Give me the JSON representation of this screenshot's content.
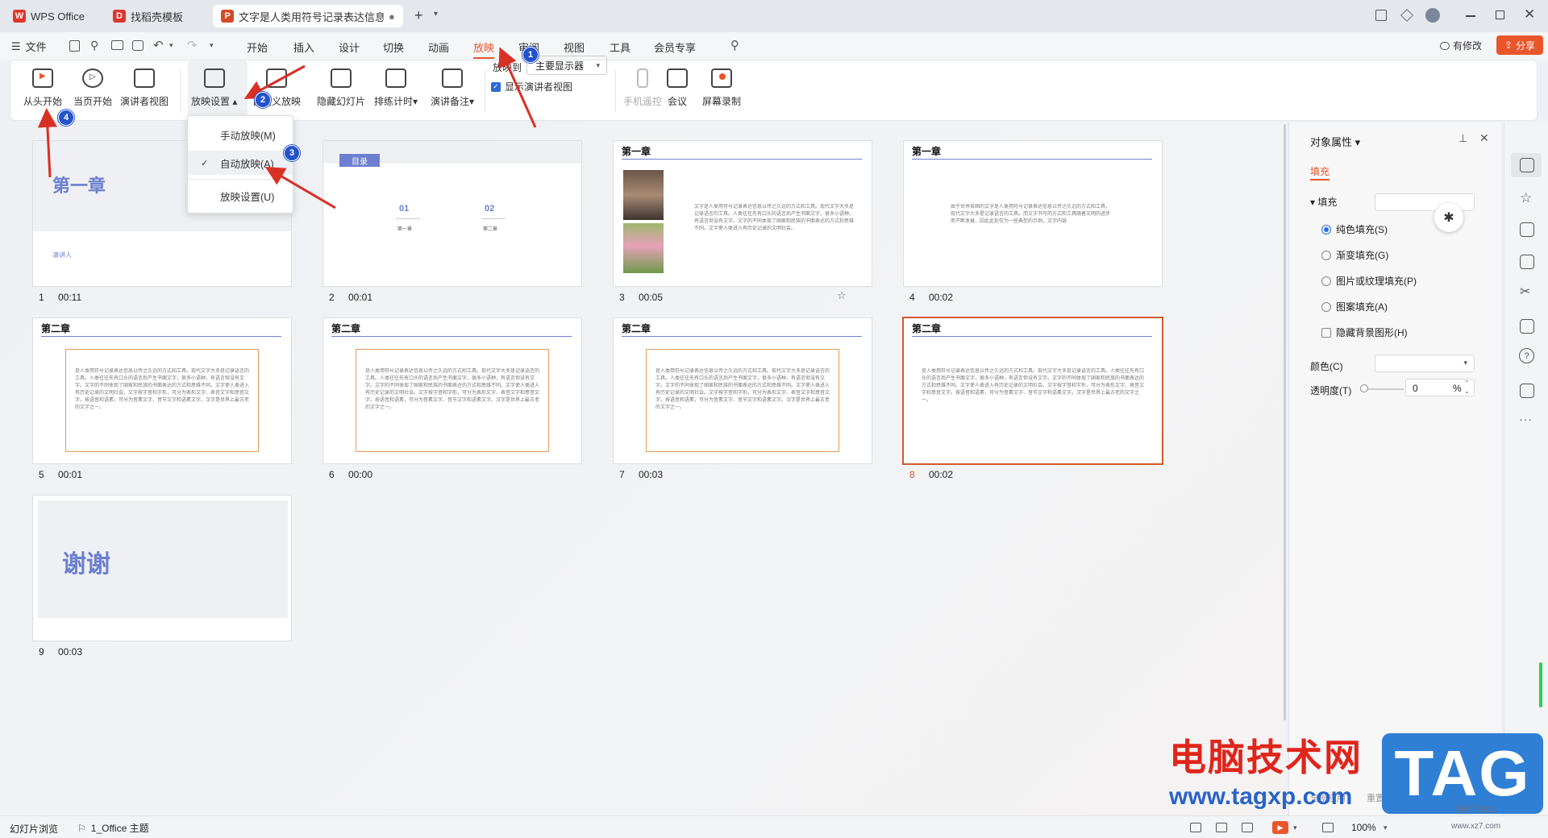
{
  "tabs": [
    {
      "label": "WPS Office",
      "icon": "wps-logo-icon"
    },
    {
      "label": "找稻壳模板",
      "icon": "docer-logo-icon"
    },
    {
      "label": "文字是人类用符号记录表达信息以",
      "icon": "presentation-file-icon"
    }
  ],
  "menubar": {
    "file": "文件",
    "items": [
      "开始",
      "插入",
      "设计",
      "切换",
      "动画",
      "放映",
      "审阅",
      "视图",
      "工具",
      "会员专享"
    ],
    "active": "放映",
    "has_changes": "有修改",
    "share": "分享"
  },
  "ribbon": {
    "from_start": "从头开始",
    "from_current": "当页开始",
    "presenter_view": "演讲者视图",
    "show_settings": "放映设置",
    "custom_show": "自定义放映",
    "custom_show_partial": "放映",
    "hide_slide": "隐藏幻灯片",
    "rehearse": "排练计时",
    "speaker_notes": "演讲备注",
    "show_on_label": "放映到",
    "show_on_value": "主要显示器",
    "show_presenter_view": "显示演讲者视图",
    "phone_remote": "手机遥控",
    "meeting": "会议",
    "screen_record": "屏幕录制"
  },
  "dropdown": {
    "items": [
      "手动放映(M)",
      "自动放映(A)",
      "放映设置(U)"
    ],
    "selected": "自动放映(A)"
  },
  "badges": [
    "1",
    "2",
    "3",
    "4"
  ],
  "slides": [
    {
      "num": "1",
      "time": "00:11",
      "title": "第一章",
      "sub": "演讲人"
    },
    {
      "num": "2",
      "time": "00:01",
      "title": "目录",
      "items": [
        {
          "n": "01",
          "t": "第一章"
        },
        {
          "n": "02",
          "t": "第二章"
        }
      ]
    },
    {
      "num": "3",
      "time": "00:05",
      "title": "第一章",
      "body": "文字是人类用符号记录表达信息以传之久远的方式和工具。现代文字大多是记录语言的工具。人类往往先有口头的语言后产生书面文字，很多小语种，有语言但没有文字。文字的不同体现了国家和民族的书面表达的方式和思维不同。文字使人类进入有历史记录的文明社会。"
    },
    {
      "num": "4",
      "time": "00:02",
      "title": "第一章",
      "body": "由于世界各国的文字是人类用符号记录表达信息以传之久远的方式和工具，现代文字大多是记录语言的工具。而文字书写的方式和工具随着文明的进步而不断发展，因此此处仅为一些典型的示例，文字内容"
    },
    {
      "num": "5",
      "time": "00:01",
      "title": "第二章",
      "body": "是人类用符号记录表达信息以传之久远的方式和工具。现代文字大多是记录语言的工具。人类往往先有口头的语言后产生书面文字，很多小语种，有语言但没有文字。文字的不同体现了国家和民族的书面表达的方式和思维不同。文字使人类进入有历史记录的文明社会。文字按字音和字形，可分为表形文字、表音文字和意音文字。按语音和语素，可分为音素文字、音节文字和语素文字。汉字是世界上最古老的文字之一。"
    },
    {
      "num": "6",
      "time": "00:00",
      "title": "第二章",
      "body": "是人类用符号记录表达信息以传之久远的方式和工具。现代文字大多是记录语言的工具。人类往往先有口头的语言后产生书面文字，很多小语种，有语言但没有文字。文字的不同体现了国家和民族的书面表达的方式和思维不同。文字使人类进入有历史记录的文明社会。文字按字音和字形，可分为表形文字、表音文字和意音文字。按语音和语素，可分为音素文字、音节文字和语素文字。汉字是世界上最古老的文字之一。"
    },
    {
      "num": "7",
      "time": "00:03",
      "title": "第二章",
      "body": "是人类用符号记录表达信息以传之久远的方式和工具。现代文字大多是记录语言的工具。人类往往先有口头的语言后产生书面文字，很多小语种，有语言但没有文字。文字的不同体现了国家和民族的书面表达的方式和思维不同。文字使人类进入有历史记录的文明社会。文字按字音和字形，可分为表形文字、表音文字和意音文字。按语音和语素，可分为音素文字、音节文字和语素文字。汉字是世界上最古老的文字之一。"
    },
    {
      "num": "8",
      "time": "00:02",
      "title": "第二章",
      "body": "是人类用符号记录表达信息以传之久远的方式和工具。现代文字大多是记录语言的工具。人类往往先有口头的语言后产生书面文字，很多小语种，有语言但没有文字。文字的不同体现了国家和民族的书面表达的方式和思维不同。文字使人类进入有历史记录的文明社会。文字按字音和字形，可分为表形文字、表音文字和意音文字。按语音和语素，可分为音素文字、音节文字和语素文字。汉字是世界上最古老的文字之一。"
    },
    {
      "num": "9",
      "time": "00:03",
      "title": "谢谢"
    }
  ],
  "panel": {
    "title": "对象属性",
    "tab_fill": "填充",
    "section_fill": "填充",
    "options": [
      "纯色填充(S)",
      "渐变填充(G)",
      "图片或纹理填充(P)",
      "图案填充(A)"
    ],
    "hide_bg": "隐藏背景图形(H)",
    "color_label": "颜色(C)",
    "transparency_label": "透明度(T)",
    "transparency_value": "0",
    "transparency_unit": "%",
    "apply_all": "全部应用",
    "reset_bg": "重置背景"
  },
  "status": {
    "view": "幻灯片浏览",
    "theme": "1_Office 主题",
    "zoom": "100%"
  },
  "watermark": {
    "brand": "电脑技术网",
    "url": "www.tagxp.com",
    "tag": "TAG",
    "small": "极光下载站",
    "small_url": "www.xz7.com"
  },
  "colors": {
    "accent": "#e8562a",
    "slide_title_blue": "#6d7fd0",
    "badge_blue": "#2453c9",
    "selected_border": "#d2592f"
  }
}
